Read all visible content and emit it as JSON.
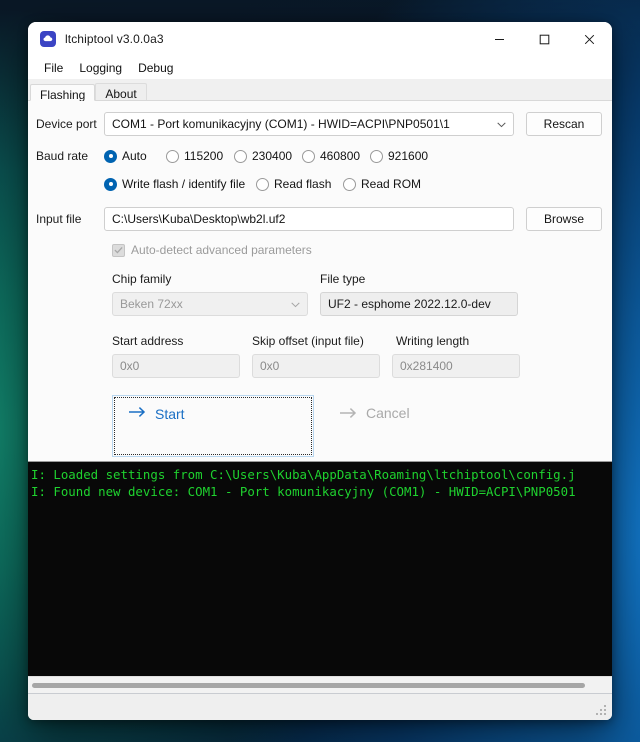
{
  "window": {
    "title": "ltchiptool v3.0.0a3",
    "icon": "cloud-chip-icon",
    "controls": {
      "minimize": "minimize-icon",
      "maximize": "maximize-icon",
      "close": "close-icon"
    }
  },
  "menubar": {
    "items": [
      {
        "label": "File"
      },
      {
        "label": "Logging"
      },
      {
        "label": "Debug"
      }
    ]
  },
  "tabs": [
    {
      "label": "Flashing",
      "active": true
    },
    {
      "label": "About",
      "active": false
    }
  ],
  "form": {
    "device_port": {
      "label": "Device port",
      "value": "COM1 - Port komunikacyjny (COM1) - HWID=ACPI\\PNP0501\\1",
      "rescan_label": "Rescan"
    },
    "baud_rate": {
      "label": "Baud rate",
      "options": [
        {
          "label": "Auto",
          "selected": true
        },
        {
          "label": "115200",
          "selected": false
        },
        {
          "label": "230400",
          "selected": false
        },
        {
          "label": "460800",
          "selected": false
        },
        {
          "label": "921600",
          "selected": false
        }
      ]
    },
    "operation": {
      "options": [
        {
          "label": "Write flash / identify file",
          "selected": true
        },
        {
          "label": "Read flash",
          "selected": false
        },
        {
          "label": "Read ROM",
          "selected": false
        }
      ]
    },
    "input_file": {
      "label": "Input file",
      "value": "C:\\Users\\Kuba\\Desktop\\wb2l.uf2",
      "browse_label": "Browse"
    },
    "auto_detect": {
      "label": "Auto-detect advanced parameters",
      "checked": true,
      "enabled": false
    },
    "chip_family": {
      "label": "Chip family",
      "value": "Beken 72xx"
    },
    "file_type": {
      "label": "File type",
      "value": "UF2 - esphome 2022.12.0-dev"
    },
    "start_address": {
      "label": "Start address",
      "value": "0x0"
    },
    "skip_offset": {
      "label": "Skip offset (input file)",
      "value": "0x0"
    },
    "writing_length": {
      "label": "Writing length",
      "value": "0x281400"
    },
    "start_button": {
      "label": "Start",
      "icon": "arrow-right-icon"
    },
    "cancel_button": {
      "label": "Cancel",
      "icon": "arrow-right-icon"
    }
  },
  "terminal": {
    "lines": [
      "I: Loaded settings from C:\\Users\\Kuba\\AppData\\Roaming\\ltchiptool\\config.j",
      "I: Found new device: COM1 - Port komunikacyjny (COM1) - HWID=ACPI\\PNP0501"
    ],
    "text_color": "#1fd22f",
    "background_color": "#080808"
  },
  "colors": {
    "accent": "#0063b1",
    "link": "#1a6fc4",
    "disabled_text": "#9b9b9b"
  }
}
